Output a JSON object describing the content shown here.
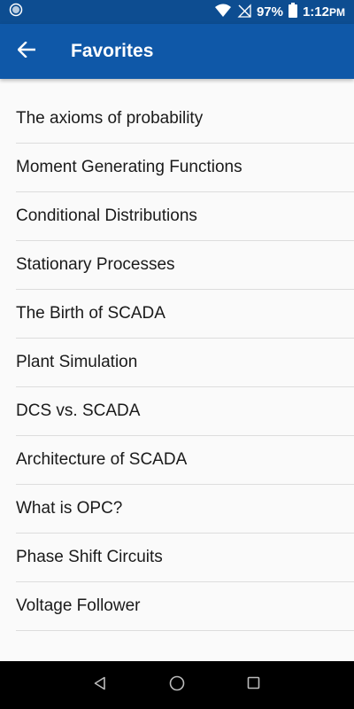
{
  "status_bar": {
    "battery": "97%",
    "time": "1:12",
    "time_suffix": "PM",
    "icons": [
      "app-notification-icon",
      "wifi-icon",
      "no-signal-icon",
      "battery-icon"
    ]
  },
  "app_bar": {
    "title": "Favorites",
    "back_icon": "arrow-back-icon"
  },
  "favorites": [
    "The axioms of probability",
    "Moment Generating Functions",
    "Conditional Distributions",
    "Stationary Processes",
    "The Birth of SCADA",
    "Plant Simulation",
    "DCS vs. SCADA",
    "Architecture of SCADA",
    "What is OPC?",
    "Phase Shift Circuits",
    "Voltage Follower"
  ],
  "nav_bar": {
    "icons": [
      "back-triangle-icon",
      "home-circle-icon",
      "recents-square-icon"
    ]
  },
  "colors": {
    "status_bar": "#0d4d91",
    "app_bar": "#0f58a8",
    "background": "#fafafa",
    "divider": "#dddddd"
  }
}
